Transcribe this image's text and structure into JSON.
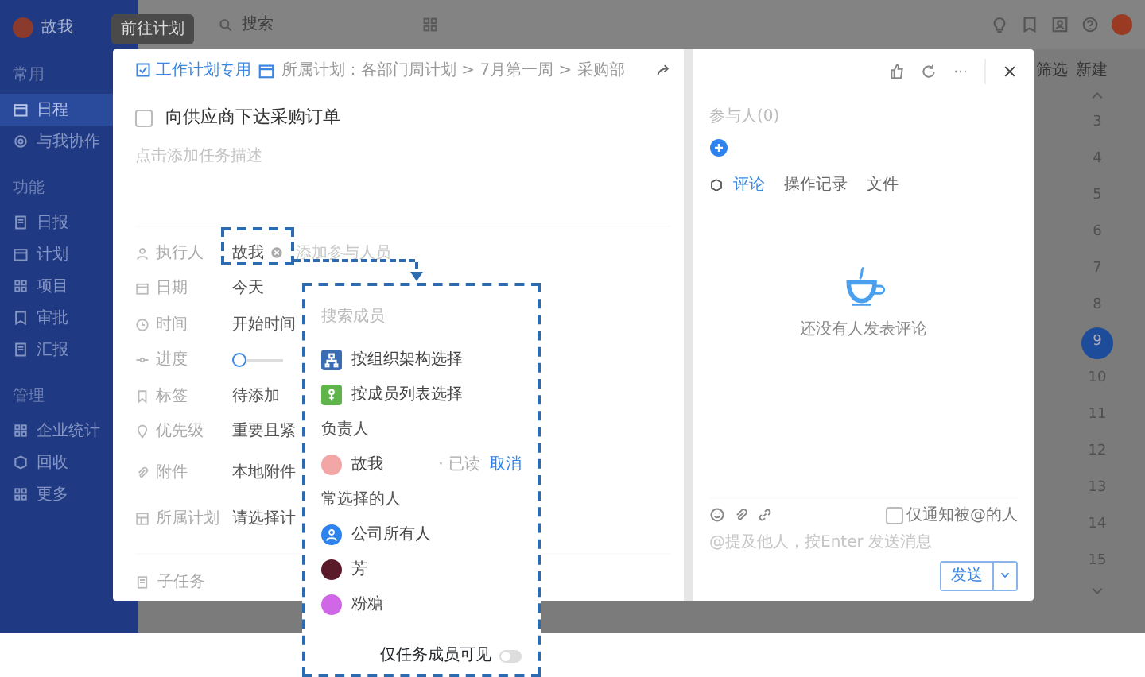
{
  "sidebar": {
    "user": "故我",
    "sections": [
      {
        "heading": "常用",
        "items": [
          {
            "label": "日程",
            "selected": true
          },
          {
            "label": "与我协作",
            "selected": false
          }
        ]
      },
      {
        "heading": "功能",
        "items": [
          {
            "label": "日报",
            "selected": false
          },
          {
            "label": "计划",
            "selected": false
          },
          {
            "label": "项目",
            "selected": false
          },
          {
            "label": "审批",
            "selected": false
          },
          {
            "label": "汇报",
            "selected": false
          }
        ]
      },
      {
        "heading": "管理",
        "items": [
          {
            "label": "企业统计",
            "selected": false
          },
          {
            "label": "回收",
            "selected": false
          },
          {
            "label": "更多",
            "selected": false
          }
        ]
      }
    ]
  },
  "tooltip": "前往计划",
  "search": {
    "placeholder": "搜索"
  },
  "calendar": {
    "filter": "筛选",
    "create": "新建",
    "hours": [
      {
        "label": "3",
        "selected": false
      },
      {
        "label": "4",
        "selected": false
      },
      {
        "label": "5",
        "selected": false
      },
      {
        "label": "6",
        "selected": false
      },
      {
        "label": "7",
        "selected": false
      },
      {
        "label": "8",
        "selected": false
      },
      {
        "label": "9",
        "selected": true
      },
      {
        "label": "10",
        "selected": false
      },
      {
        "label": "11",
        "selected": false
      },
      {
        "label": "12",
        "selected": false
      },
      {
        "label": "13",
        "selected": false
      },
      {
        "label": "14",
        "selected": false
      },
      {
        "label": "15",
        "selected": false
      }
    ]
  },
  "modal": {
    "tag": "工作计划专用",
    "breadcrumb": "所属计划：各部门周计划 > 7月第一周 > 采购部",
    "task": {
      "title": "向供应商下达采购订单",
      "done": false
    },
    "description": {
      "placeholder": "点击添加任务描述"
    },
    "fields": [
      {
        "kind": "assignee",
        "label": "执行人",
        "value": "故我",
        "extra": "添加参与人员"
      },
      {
        "kind": "date",
        "label": "日期",
        "value": "今天"
      },
      {
        "kind": "time",
        "label": "时间",
        "value": "开始时间"
      },
      {
        "kind": "progress",
        "label": "进度",
        "level": 0
      },
      {
        "kind": "tag",
        "label": "标签",
        "value": "待添加"
      },
      {
        "kind": "priority",
        "label": "优先级",
        "value": "重要且紧"
      },
      {
        "kind": "attachment",
        "label": "附件",
        "value": "本地附件"
      },
      {
        "kind": "plan",
        "label": "所属计划",
        "value": "请选择计"
      }
    ],
    "subtasks": "子任务"
  },
  "comments": {
    "participants": "参与人(0)",
    "tabs": [
      {
        "label": "评论",
        "selected": true
      },
      {
        "label": "操作记录",
        "selected": false
      },
      {
        "label": "文件",
        "selected": false
      }
    ],
    "empty": "还没有人发表评论",
    "notify": {
      "label": "仅通知被@的人",
      "checked": false
    },
    "input": {
      "placeholder": "@提及他人，按Enter 发送消息"
    },
    "send": "发送"
  },
  "picker": {
    "search": {
      "placeholder": "搜索成员"
    },
    "options": [
      {
        "kind": "org",
        "label": "按组织架构选择"
      },
      {
        "kind": "list",
        "label": "按成员列表选择"
      }
    ],
    "owner_heading": "负责人",
    "owner": {
      "name": "故我",
      "status": "· 已读",
      "action": "取消"
    },
    "frequent_heading": "常选择的人",
    "frequent": [
      {
        "kind": "group",
        "name": "公司所有人"
      },
      {
        "kind": "person",
        "name": "芳"
      },
      {
        "kind": "person",
        "name": "粉糖"
      }
    ],
    "members_only": {
      "label": "仅任务成员可见",
      "on": false
    }
  }
}
